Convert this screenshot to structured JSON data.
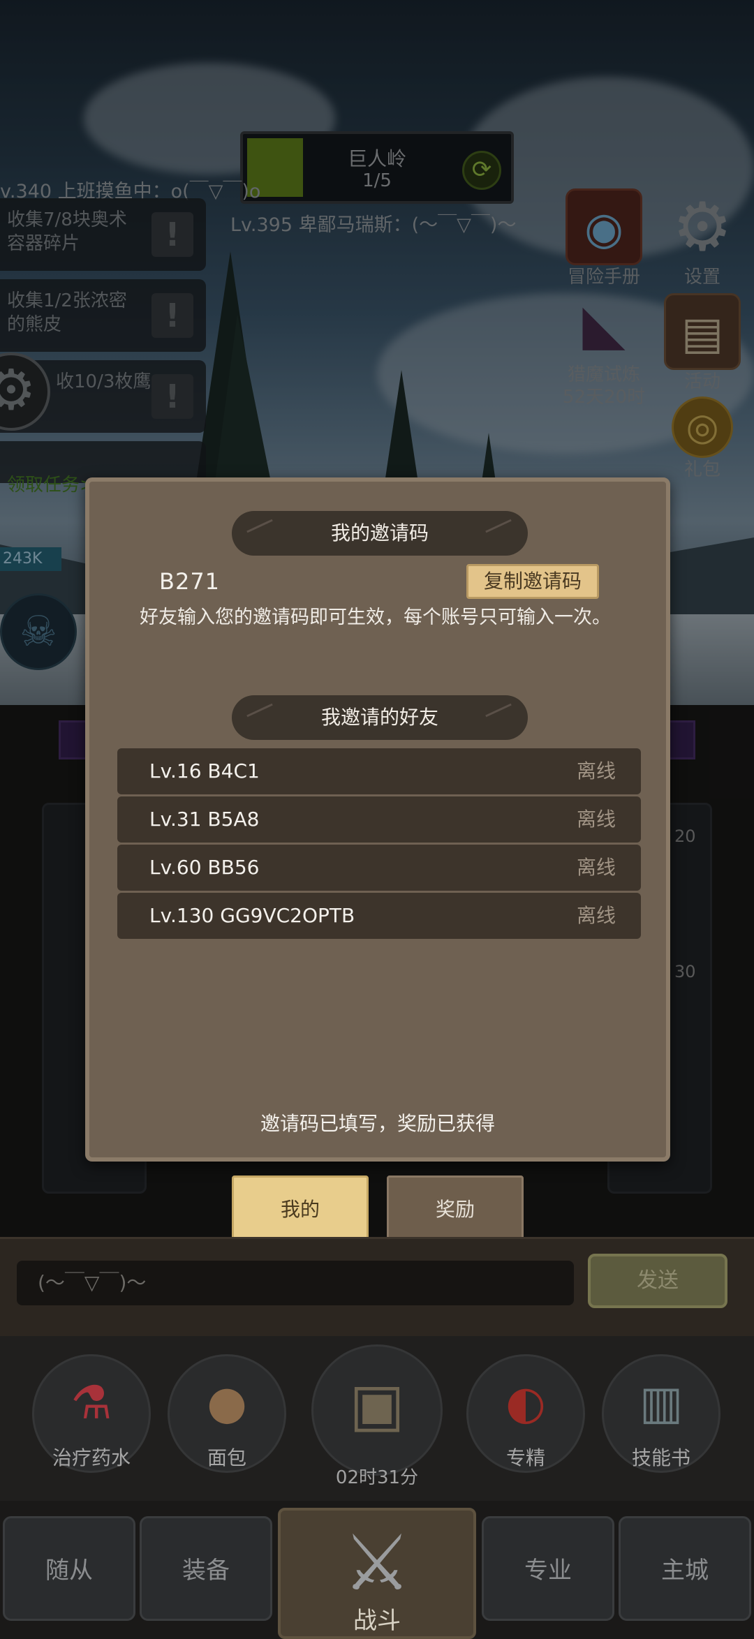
{
  "hud": {
    "zone_name": "巨人岭",
    "zone_progress": "1/5",
    "chat_line_1": "v.340 上班摸鱼中：o(￣▽￣)o",
    "chat_line_2": "Lv.395 卑鄙马瑞斯：(～￣▽￣)～"
  },
  "quests": [
    {
      "text": "收集7/8块奥术容器碎片"
    },
    {
      "text": "收集1/2张浓密的熊皮"
    },
    {
      "text": "收10/3枚鹰"
    }
  ],
  "quest_claim": "领取任务>",
  "power_value": "243K",
  "right_menu": {
    "adventure_book": "冒险手册",
    "settings": "设置",
    "demon_trial": "猎魔试炼",
    "demon_trial_timer": "52天20时",
    "activity": "活动",
    "gift": "礼包"
  },
  "modal": {
    "my_code_title": "我的邀请码",
    "my_code": "B271",
    "copy_button": "复制邀请码",
    "description": "好友输入您的邀请码即可生效，每个账号只可输入一次。",
    "friends_title": "我邀请的好友",
    "friends": [
      {
        "name": "Lv.16 B4C1",
        "status": "离线"
      },
      {
        "name": "Lv.31 B5A8",
        "status": "离线"
      },
      {
        "name": "Lv.60 BB56",
        "status": "离线"
      },
      {
        "name": "Lv.130 GG9VC2OPTB",
        "status": "离线"
      }
    ],
    "status_note": "邀请码已填写，奖励已获得"
  },
  "tabs": {
    "mine": "我的",
    "reward": "奖励"
  },
  "chat": {
    "input_value": "(～￣▽￣)～",
    "send": "发送"
  },
  "items": {
    "potion": "治疗药水",
    "bread": "面包",
    "timer": "02时31分",
    "specialize": "专精",
    "skill_book": "技能书"
  },
  "nav": {
    "followers": "随从",
    "equipment": "装备",
    "battle": "战斗",
    "profession": "专业",
    "main_city": "主城"
  },
  "side_badges": {
    "badge_1": "20",
    "badge_2": "30"
  }
}
